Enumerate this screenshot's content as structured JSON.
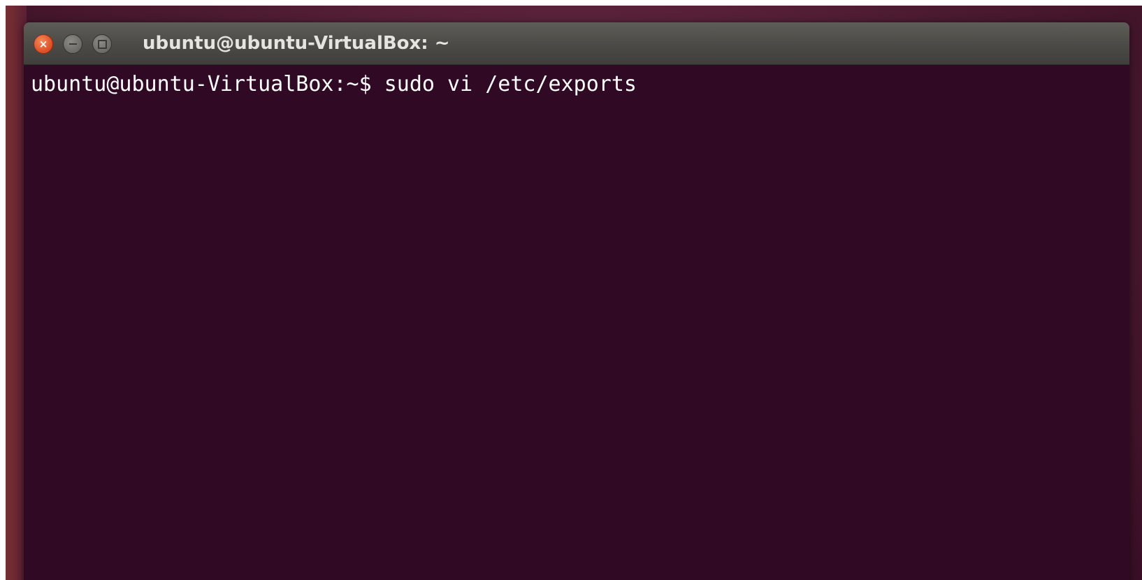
{
  "window": {
    "title": "ubuntu@ubuntu-VirtualBox: ~",
    "controls": {
      "close_icon": "close-icon",
      "minimize_icon": "minimize-icon",
      "maximize_icon": "maximize-icon"
    }
  },
  "terminal": {
    "prompt": "ubuntu@ubuntu-VirtualBox:~$ ",
    "command": "sudo vi /etc/exports",
    "background": "#300a24",
    "foreground": "#ffffff"
  },
  "colors": {
    "close_button": "#e2542a",
    "titlebar": "#4b4a46",
    "desktop": "#4a1a30"
  }
}
